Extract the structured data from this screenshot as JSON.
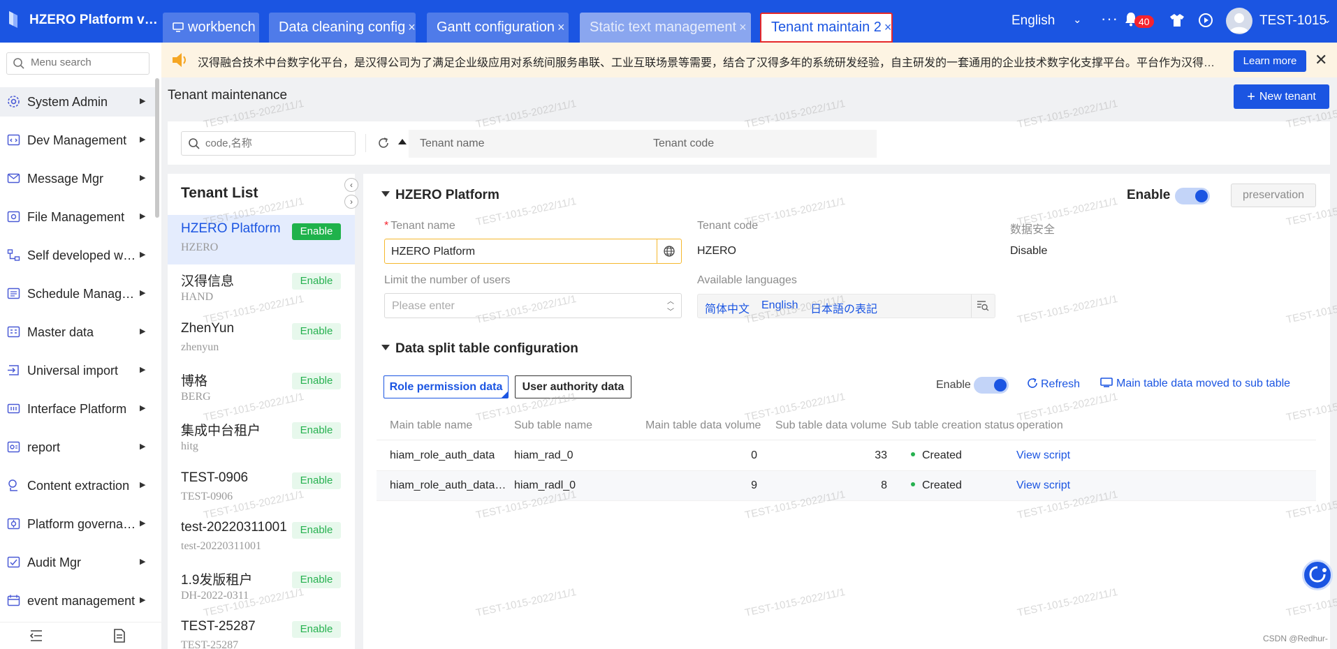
{
  "topbar": {
    "brand": "HZERO Platform verif...",
    "tabs": [
      {
        "label": "workbench",
        "closable": false,
        "state": "normal"
      },
      {
        "label": "Data cleaning config",
        "closable": true,
        "state": "normal"
      },
      {
        "label": "Gantt configuration",
        "closable": true,
        "state": "normal"
      },
      {
        "label": "Static text management",
        "closable": true,
        "state": "disabled"
      },
      {
        "label": "Tenant maintain 2",
        "closable": true,
        "state": "active"
      }
    ],
    "close_glyph": "×",
    "language": "English",
    "notification_count": "40",
    "username": "TEST-1015",
    "accent_color": "#1b55e2"
  },
  "notice": {
    "text": "汉得融合技术中台数字化平台，是汉得公司为了满足企业级应用对系统间服务串联、工业互联场景等需要，结合了汉得多年的系统研发经验，自主研发的一套通用的企业技术数字化支撑平台。平台作为汉得融合技术中台（H...",
    "learn_more": "Learn more"
  },
  "sidebar": {
    "search_placeholder": "Menu search",
    "items": [
      {
        "label": "System Admin",
        "icon": "gear-icon"
      },
      {
        "label": "Dev Management",
        "icon": "code-icon"
      },
      {
        "label": "Message Mgr",
        "icon": "mail-icon"
      },
      {
        "label": "File Management",
        "icon": "file-icon"
      },
      {
        "label": "Self developed wor...",
        "icon": "workflow-icon"
      },
      {
        "label": "Schedule Manage...",
        "icon": "schedule-icon"
      },
      {
        "label": "Master data",
        "icon": "database-icon"
      },
      {
        "label": "Universal import",
        "icon": "import-icon"
      },
      {
        "label": "Interface Platform",
        "icon": "interface-icon"
      },
      {
        "label": "report",
        "icon": "report-icon"
      },
      {
        "label": "Content extraction",
        "icon": "extract-icon"
      },
      {
        "label": "Platform governance",
        "icon": "governance-icon"
      },
      {
        "label": "Audit Mgr",
        "icon": "audit-icon"
      },
      {
        "label": "event management",
        "icon": "event-icon"
      }
    ]
  },
  "page": {
    "title": "Tenant maintenance",
    "new_button": "New tenant",
    "search_placeholder": "code,名称",
    "columns": {
      "name": "Tenant name",
      "code": "Tenant code"
    }
  },
  "tenant_list": {
    "heading": "Tenant List",
    "tenants": [
      {
        "name": "HZERO Platform",
        "code": "HZERO",
        "status": "Enable"
      },
      {
        "name": "汉得信息",
        "code": "HAND",
        "status": "Enable"
      },
      {
        "name": "ZhenYun",
        "code": "zhenyun",
        "status": "Enable"
      },
      {
        "name": "博格",
        "code": "BERG",
        "status": "Enable"
      },
      {
        "name": "集成中台租户",
        "code": "hitg",
        "status": "Enable"
      },
      {
        "name": "TEST-0906",
        "code": "TEST-0906",
        "status": "Enable"
      },
      {
        "name": "test-20220311001",
        "code": "test-20220311001",
        "status": "Enable"
      },
      {
        "name": "1.9发版租户",
        "code": "DH-2022-0311",
        "status": "Enable"
      },
      {
        "name": "TEST-25287",
        "code": "TEST-25287",
        "status": "Enable"
      }
    ]
  },
  "detail": {
    "title": "HZERO Platform",
    "enable_label": "Enable",
    "enabled": true,
    "save_button": "preservation",
    "fields": {
      "tenant_name_label": "Tenant name",
      "tenant_name_value": "HZERO Platform",
      "tenant_code_label": "Tenant code",
      "tenant_code_value": "HZERO",
      "data_security_label": "数据安全",
      "data_security_value": "Disable",
      "limit_users_label": "Limit the number of users",
      "limit_users_placeholder": "Please enter",
      "languages_label": "Available languages",
      "languages": [
        "简体中文",
        "English",
        "日本語の表記"
      ]
    },
    "split": {
      "title": "Data split table configuration",
      "tabs": [
        "Role permission data",
        "User authority data"
      ],
      "enable_label": "Enable",
      "refresh": "Refresh",
      "move_link": "Main table data moved to sub table",
      "columns": [
        "Main table name",
        "Sub table name",
        "Main table data volume",
        "Sub table data volume",
        "Sub table creation status",
        "operation"
      ],
      "rows": [
        {
          "main": "hiam_role_auth_data",
          "sub": "hiam_rad_0",
          "main_vol": "0",
          "sub_vol": "33",
          "status": "Created",
          "op": "View script"
        },
        {
          "main": "hiam_role_auth_data_li...",
          "sub": "hiam_radl_0",
          "main_vol": "9",
          "sub_vol": "8",
          "status": "Created",
          "op": "View script"
        }
      ]
    }
  },
  "watermark": "TEST-1015-2022/11/1",
  "credit": "CSDN @Redhur-"
}
